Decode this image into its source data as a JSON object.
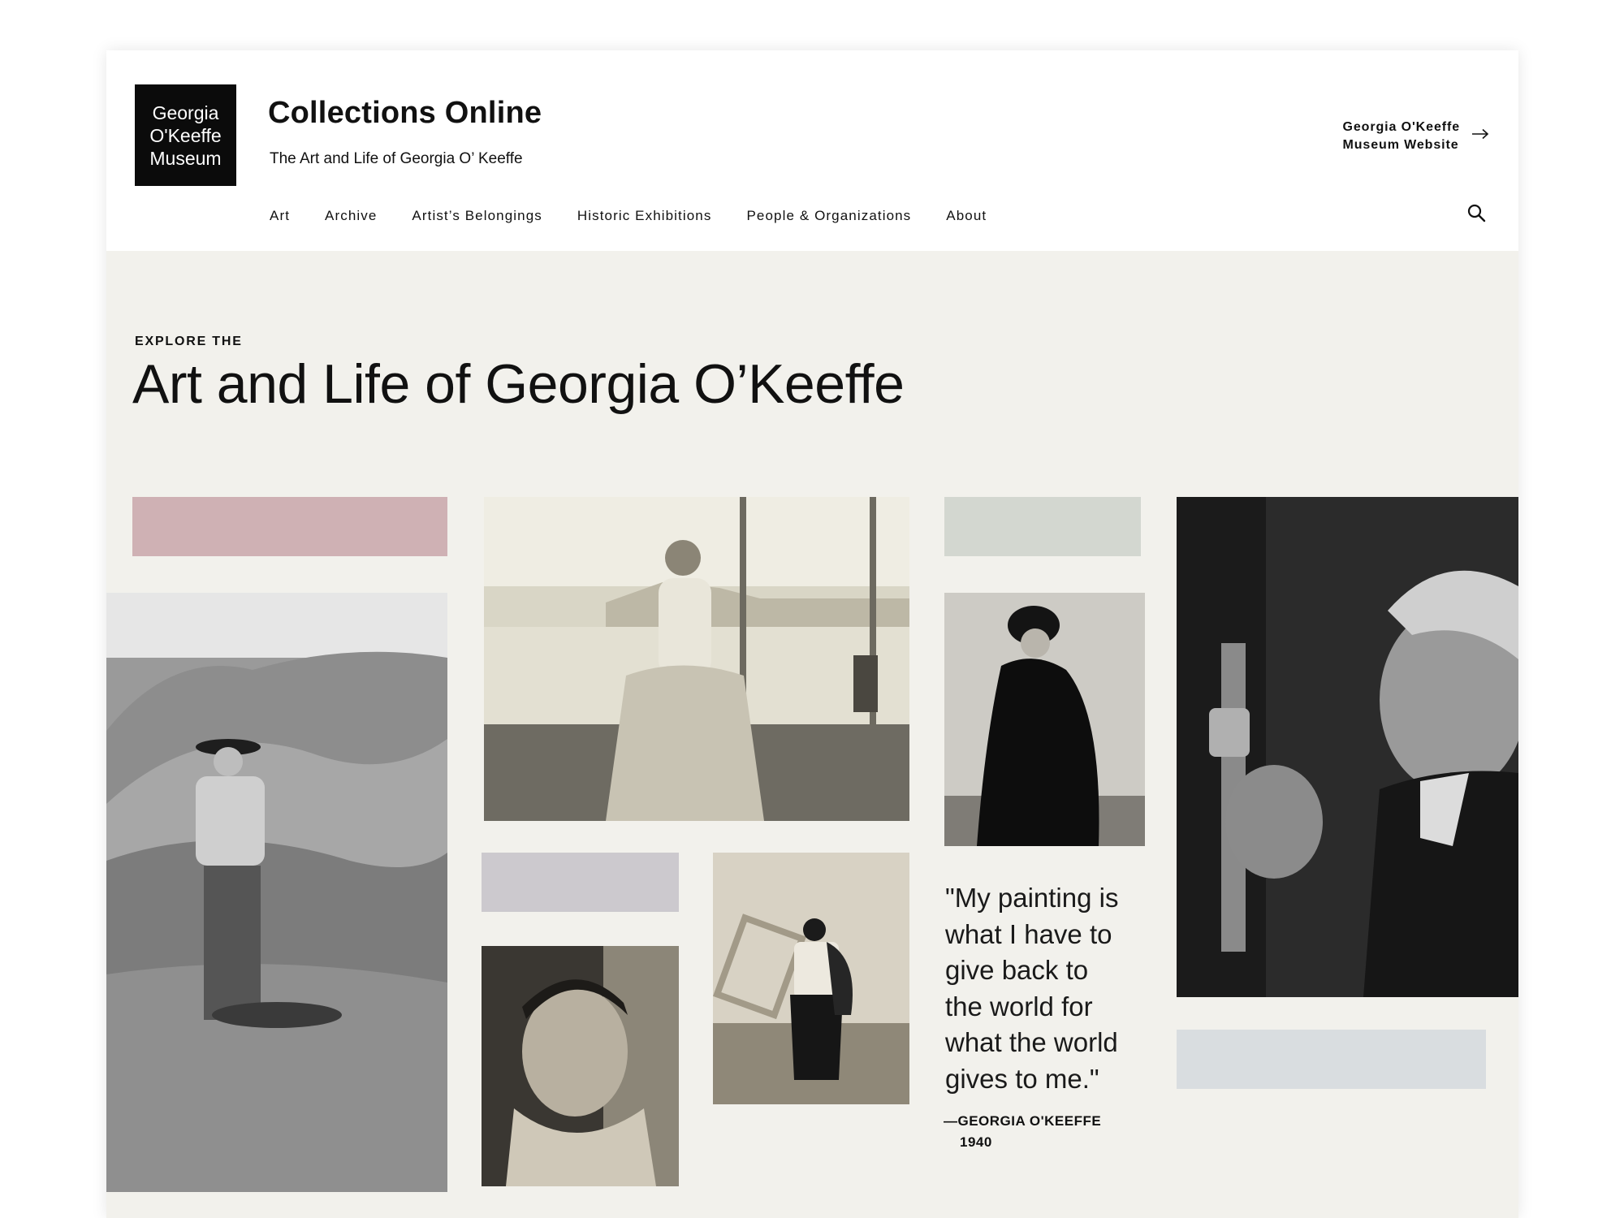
{
  "brand": {
    "logo_lines": [
      "Georgia",
      "O'Keeffe",
      "Museum"
    ],
    "app_title": "Collections Online",
    "app_subtitle": "The Art and Life of Georgia O’ Keeffe"
  },
  "external_link": {
    "line1": "Georgia O'Keeffe",
    "line2": "Museum Website",
    "icon": "arrow-right-icon"
  },
  "nav": {
    "items": [
      {
        "label": "Art"
      },
      {
        "label": "Archive"
      },
      {
        "label": "Artist’s Belongings"
      },
      {
        "label": "Historic Exhibitions"
      },
      {
        "label": "People & Organizations"
      },
      {
        "label": "About"
      }
    ],
    "search_icon": "search-icon"
  },
  "hero": {
    "eyebrow": "EXPLORE THE",
    "title": "Art and Life of Georgia O’Keeffe"
  },
  "quote": {
    "text": "\"My painting is what I have to give back to the world for what the world gives to me.\"",
    "author": "—GEORGIA O'KEEFFE",
    "year": "1940"
  },
  "colors": {
    "page_background": "#f2f1ec",
    "swatch_rose": "#cfb1b4",
    "swatch_sage": "#d3d7d0",
    "swatch_lavender": "#ccc9ce",
    "swatch_blue_gray": "#d9dde0",
    "logo_background": "#0b0b0b"
  }
}
